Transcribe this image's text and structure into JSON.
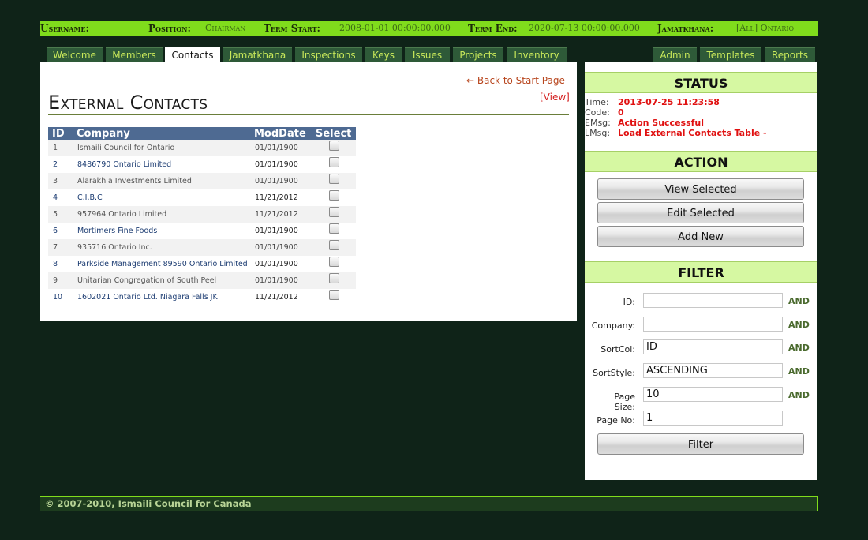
{
  "userbar": {
    "username_label": "Username:",
    "username": "",
    "position_label": "Position:",
    "position": "Chairman",
    "term_start_label": "Term Start:",
    "term_start": "2008-01-01 00:00:00.000",
    "term_end_label": "Term End:",
    "term_end": "2020-07-13 00:00:00.000",
    "jamatkhana_label": "Jamatkhana:",
    "jamatkhana": "[All] Ontario"
  },
  "tabs_left": [
    "Welcome",
    "Members",
    "Contacts",
    "Jamatkhana",
    "Inspections",
    "Keys",
    "Issues",
    "Projects",
    "Inventory"
  ],
  "tabs_right": [
    "Admin",
    "Templates",
    "Reports"
  ],
  "active_tab": "Contacts",
  "main": {
    "back_link": "← Back to Start Page",
    "view_link": "[View]",
    "title": "External Contacts",
    "columns": [
      "ID",
      "Company",
      "ModDate",
      "Select"
    ],
    "rows": [
      {
        "id": "1",
        "company": "Ismaili Council for Ontario",
        "moddate": "01/01/1900"
      },
      {
        "id": "2",
        "company": "8486790 Ontario Limited",
        "moddate": "01/01/1900"
      },
      {
        "id": "3",
        "company": "Alarakhia Investments Limited",
        "moddate": "01/01/1900"
      },
      {
        "id": "4",
        "company": "C.I.B.C",
        "moddate": "11/21/2012"
      },
      {
        "id": "5",
        "company": "957964 Ontario Limited",
        "moddate": "11/21/2012"
      },
      {
        "id": "6",
        "company": "Mortimers Fine Foods",
        "moddate": "01/01/1900"
      },
      {
        "id": "7",
        "company": "935716 Ontario Inc.",
        "moddate": "01/01/1900"
      },
      {
        "id": "8",
        "company": "Parkside Management 89590 Ontario Limited",
        "moddate": "01/01/1900"
      },
      {
        "id": "9",
        "company": "Unitarian Congregation of South Peel",
        "moddate": "01/01/1900"
      },
      {
        "id": "10",
        "company": "1602021 Ontario Ltd. Niagara Falls JK",
        "moddate": "11/21/2012"
      }
    ]
  },
  "status": {
    "heading": "STATUS",
    "time_label": "Time:",
    "time": "2013-07-25 11:23:58",
    "code_label": "Code:",
    "code": "0",
    "emsg_label": "EMsg:",
    "emsg": "Action Successful",
    "lmsg_label": "LMsg:",
    "lmsg": "Load External Contacts Table -"
  },
  "action": {
    "heading": "ACTION",
    "view_selected": "View Selected",
    "edit_selected": "Edit Selected",
    "add_new": "Add New"
  },
  "filter": {
    "heading": "FILTER",
    "and_label": "AND",
    "id_label": "ID:",
    "id_value": "",
    "company_label": "Company:",
    "company_value": "",
    "sortcol_label": "SortCol:",
    "sortcol_value": "ID",
    "sortstyle_label": "SortStyle:",
    "sortstyle_value": "ASCENDING",
    "pagesize_label_1": "Page",
    "pagesize_label_2": "Size:",
    "pagesize_value": "10",
    "pageno_label": "Page No:",
    "pageno_value": "1",
    "filter_button": "Filter"
  },
  "footer": "© 2007-2010, Ismaili Council for Canada"
}
